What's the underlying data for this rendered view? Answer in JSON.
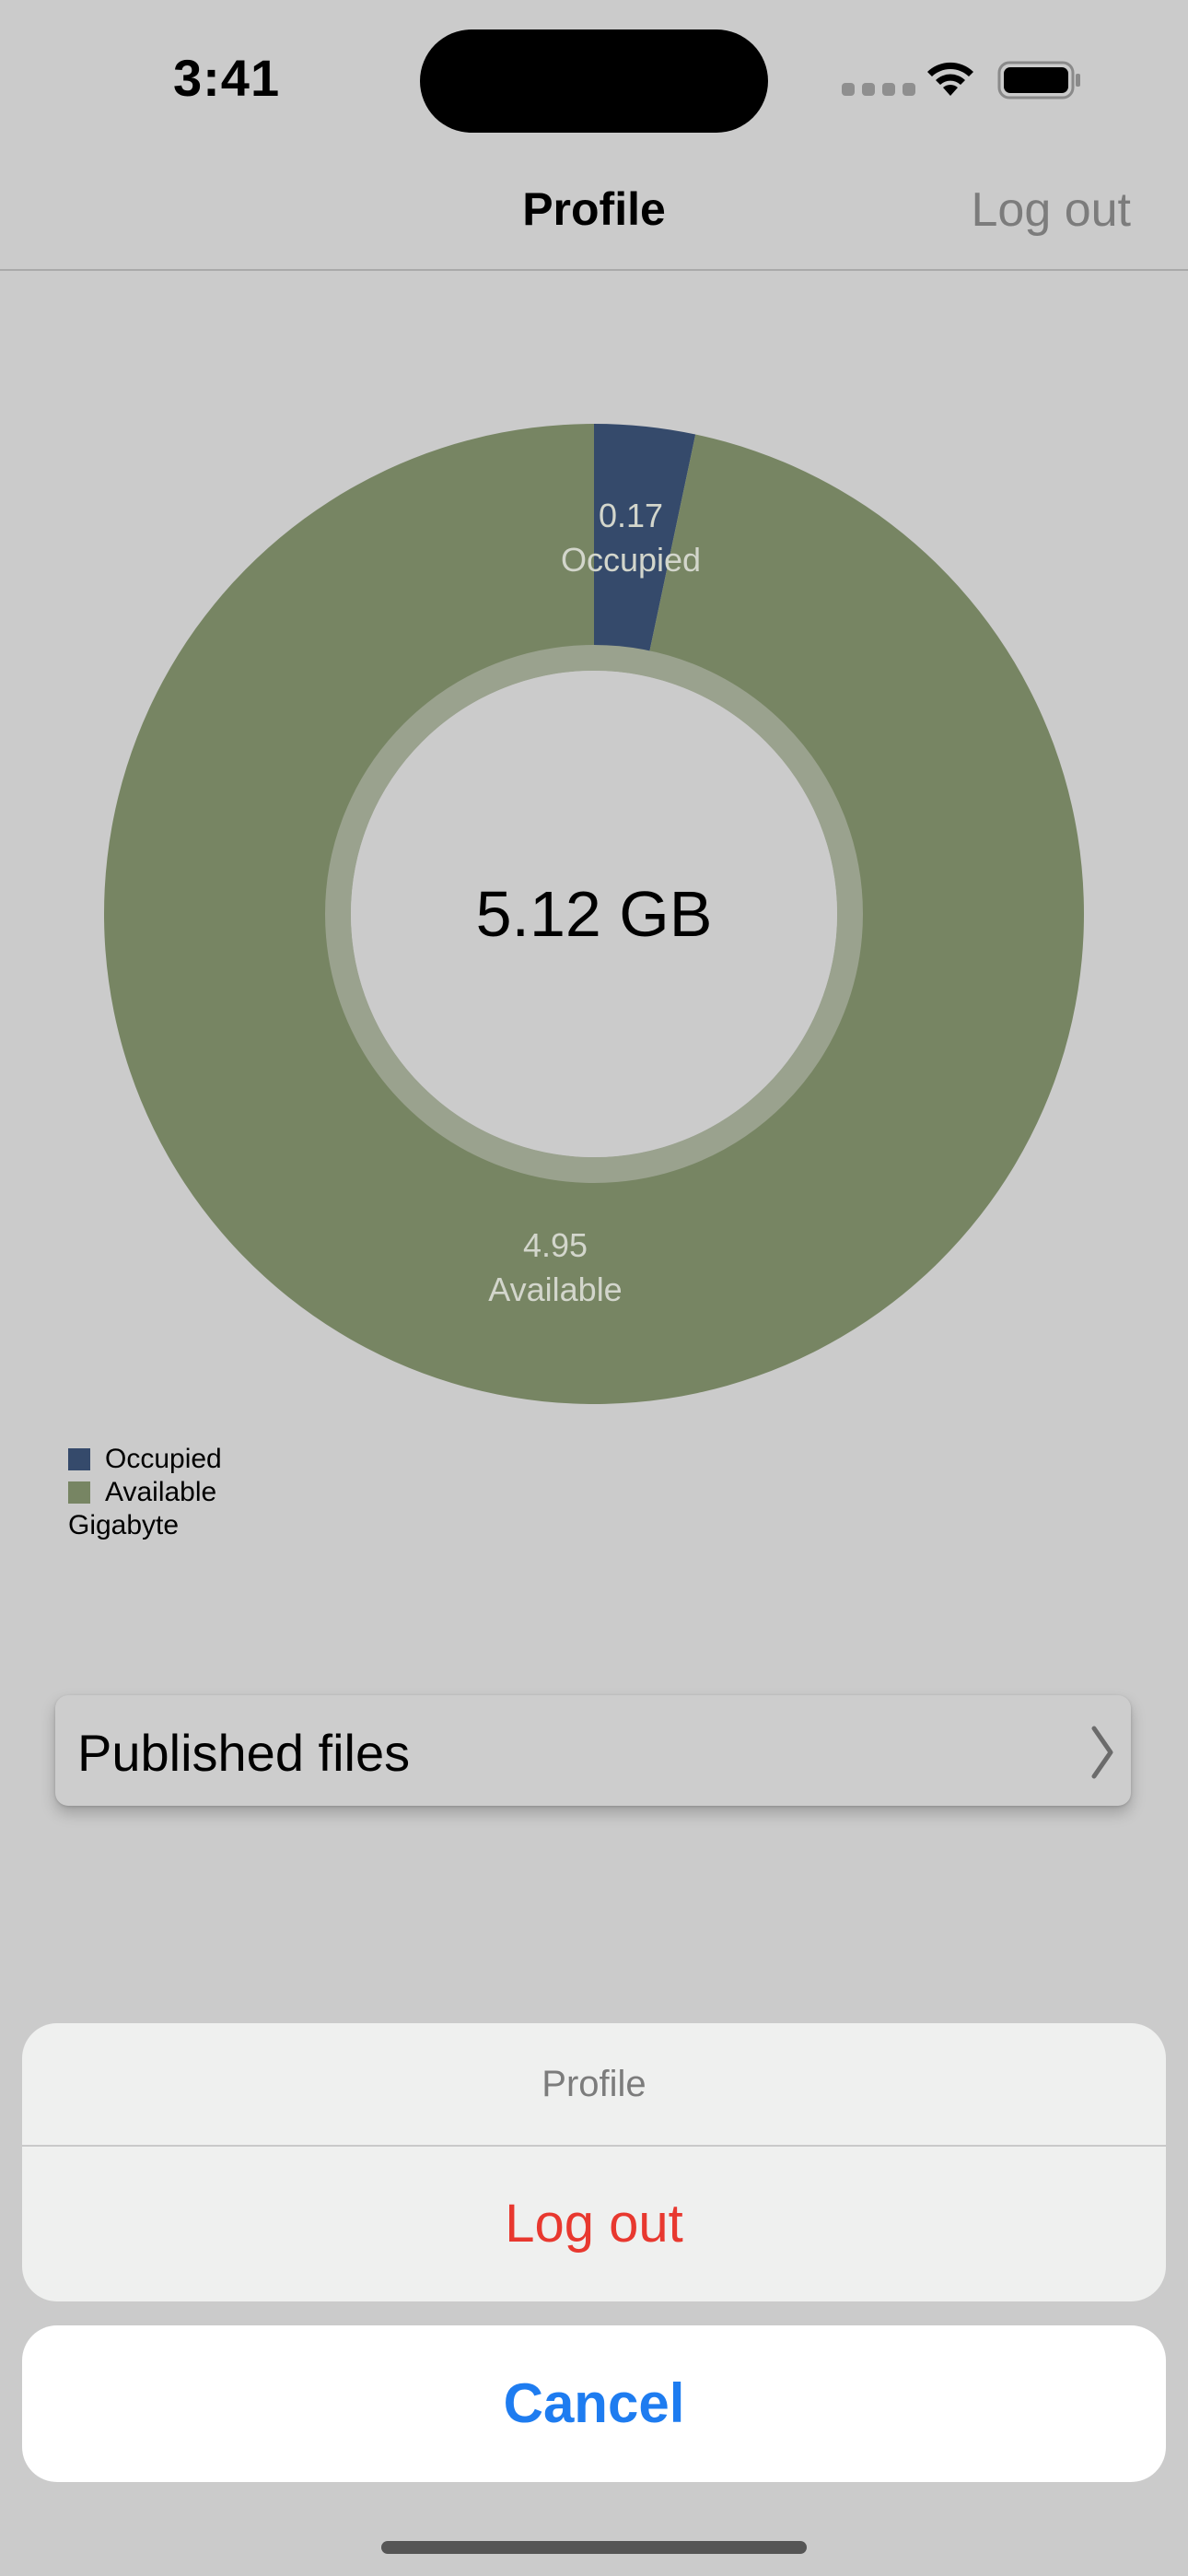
{
  "status_bar": {
    "time": "3:41"
  },
  "nav": {
    "title": "Profile",
    "logout_label": "Log out"
  },
  "chart_data": {
    "type": "donut",
    "center_label": "5.12 GB",
    "unit": "Gigabyte",
    "series": [
      {
        "name": "Occupied",
        "value": 0.17,
        "label_value": "0.17",
        "color": "#354a6b"
      },
      {
        "name": "Available",
        "value": 4.95,
        "label_value": "4.95",
        "color": "#778563"
      }
    ],
    "inner_ring_color": "#9aa28e",
    "legend_position": "bottom-left"
  },
  "published": {
    "label": "Published files"
  },
  "action_sheet": {
    "title": "Profile",
    "logout_label": "Log out",
    "cancel_label": "Cancel"
  },
  "colors": {
    "accent": "#1e7cf0",
    "destructive": "#e8382f",
    "background": "#cbcbcb"
  }
}
